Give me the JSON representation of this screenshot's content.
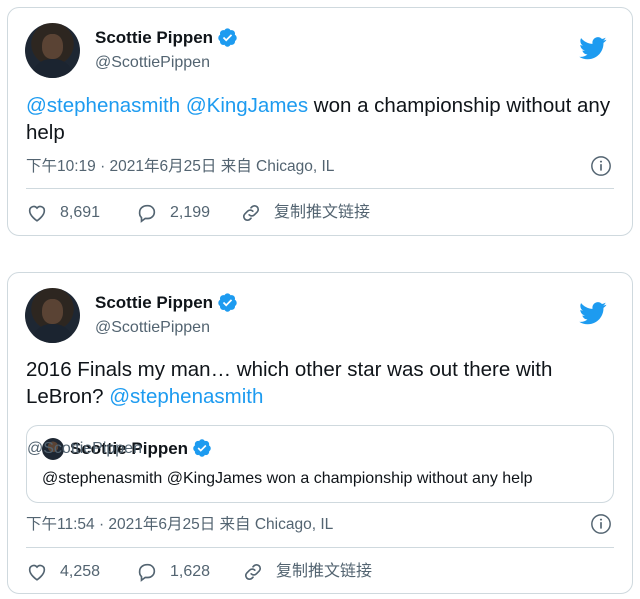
{
  "tweets": [
    {
      "author_name": "Scottie Pippen",
      "handle": "@ScottiePippen",
      "text_parts": [
        {
          "text": "@stephenasmith",
          "mention": true
        },
        {
          "text": " ",
          "mention": false
        },
        {
          "text": "@KingJames",
          "mention": true
        },
        {
          "text": " won a championship without any help",
          "mention": false
        }
      ],
      "time": "下午10:19 · 2021年6月25日 来自 Chicago, IL",
      "likes": "8,691",
      "replies": "2,199",
      "copy_link": "复制推文链接"
    },
    {
      "author_name": "Scottie Pippen",
      "handle": "@ScottiePippen",
      "text_parts": [
        {
          "text": "2016 Finals my man… which other star was out there with LeBron? ",
          "mention": false
        },
        {
          "text": "@stephenasmith",
          "mention": true
        }
      ],
      "quote": {
        "author_name": "Scottie Pippen",
        "handle": "@ScottiePippen",
        "text": "@stephenasmith @KingJames won a championship without any help"
      },
      "time": "下午11:54 · 2021年6月25日 来自 Chicago, IL",
      "likes": "4,258",
      "replies": "1,628",
      "copy_link": "复制推文链接"
    }
  ],
  "colors": {
    "accent": "#1d9bf0",
    "secondary_text": "#536471",
    "border": "#cfd9de"
  },
  "icons": [
    "twitter-bird-icon",
    "verified-badge-icon",
    "info-icon",
    "heart-icon",
    "reply-bubble-icon",
    "link-icon"
  ]
}
